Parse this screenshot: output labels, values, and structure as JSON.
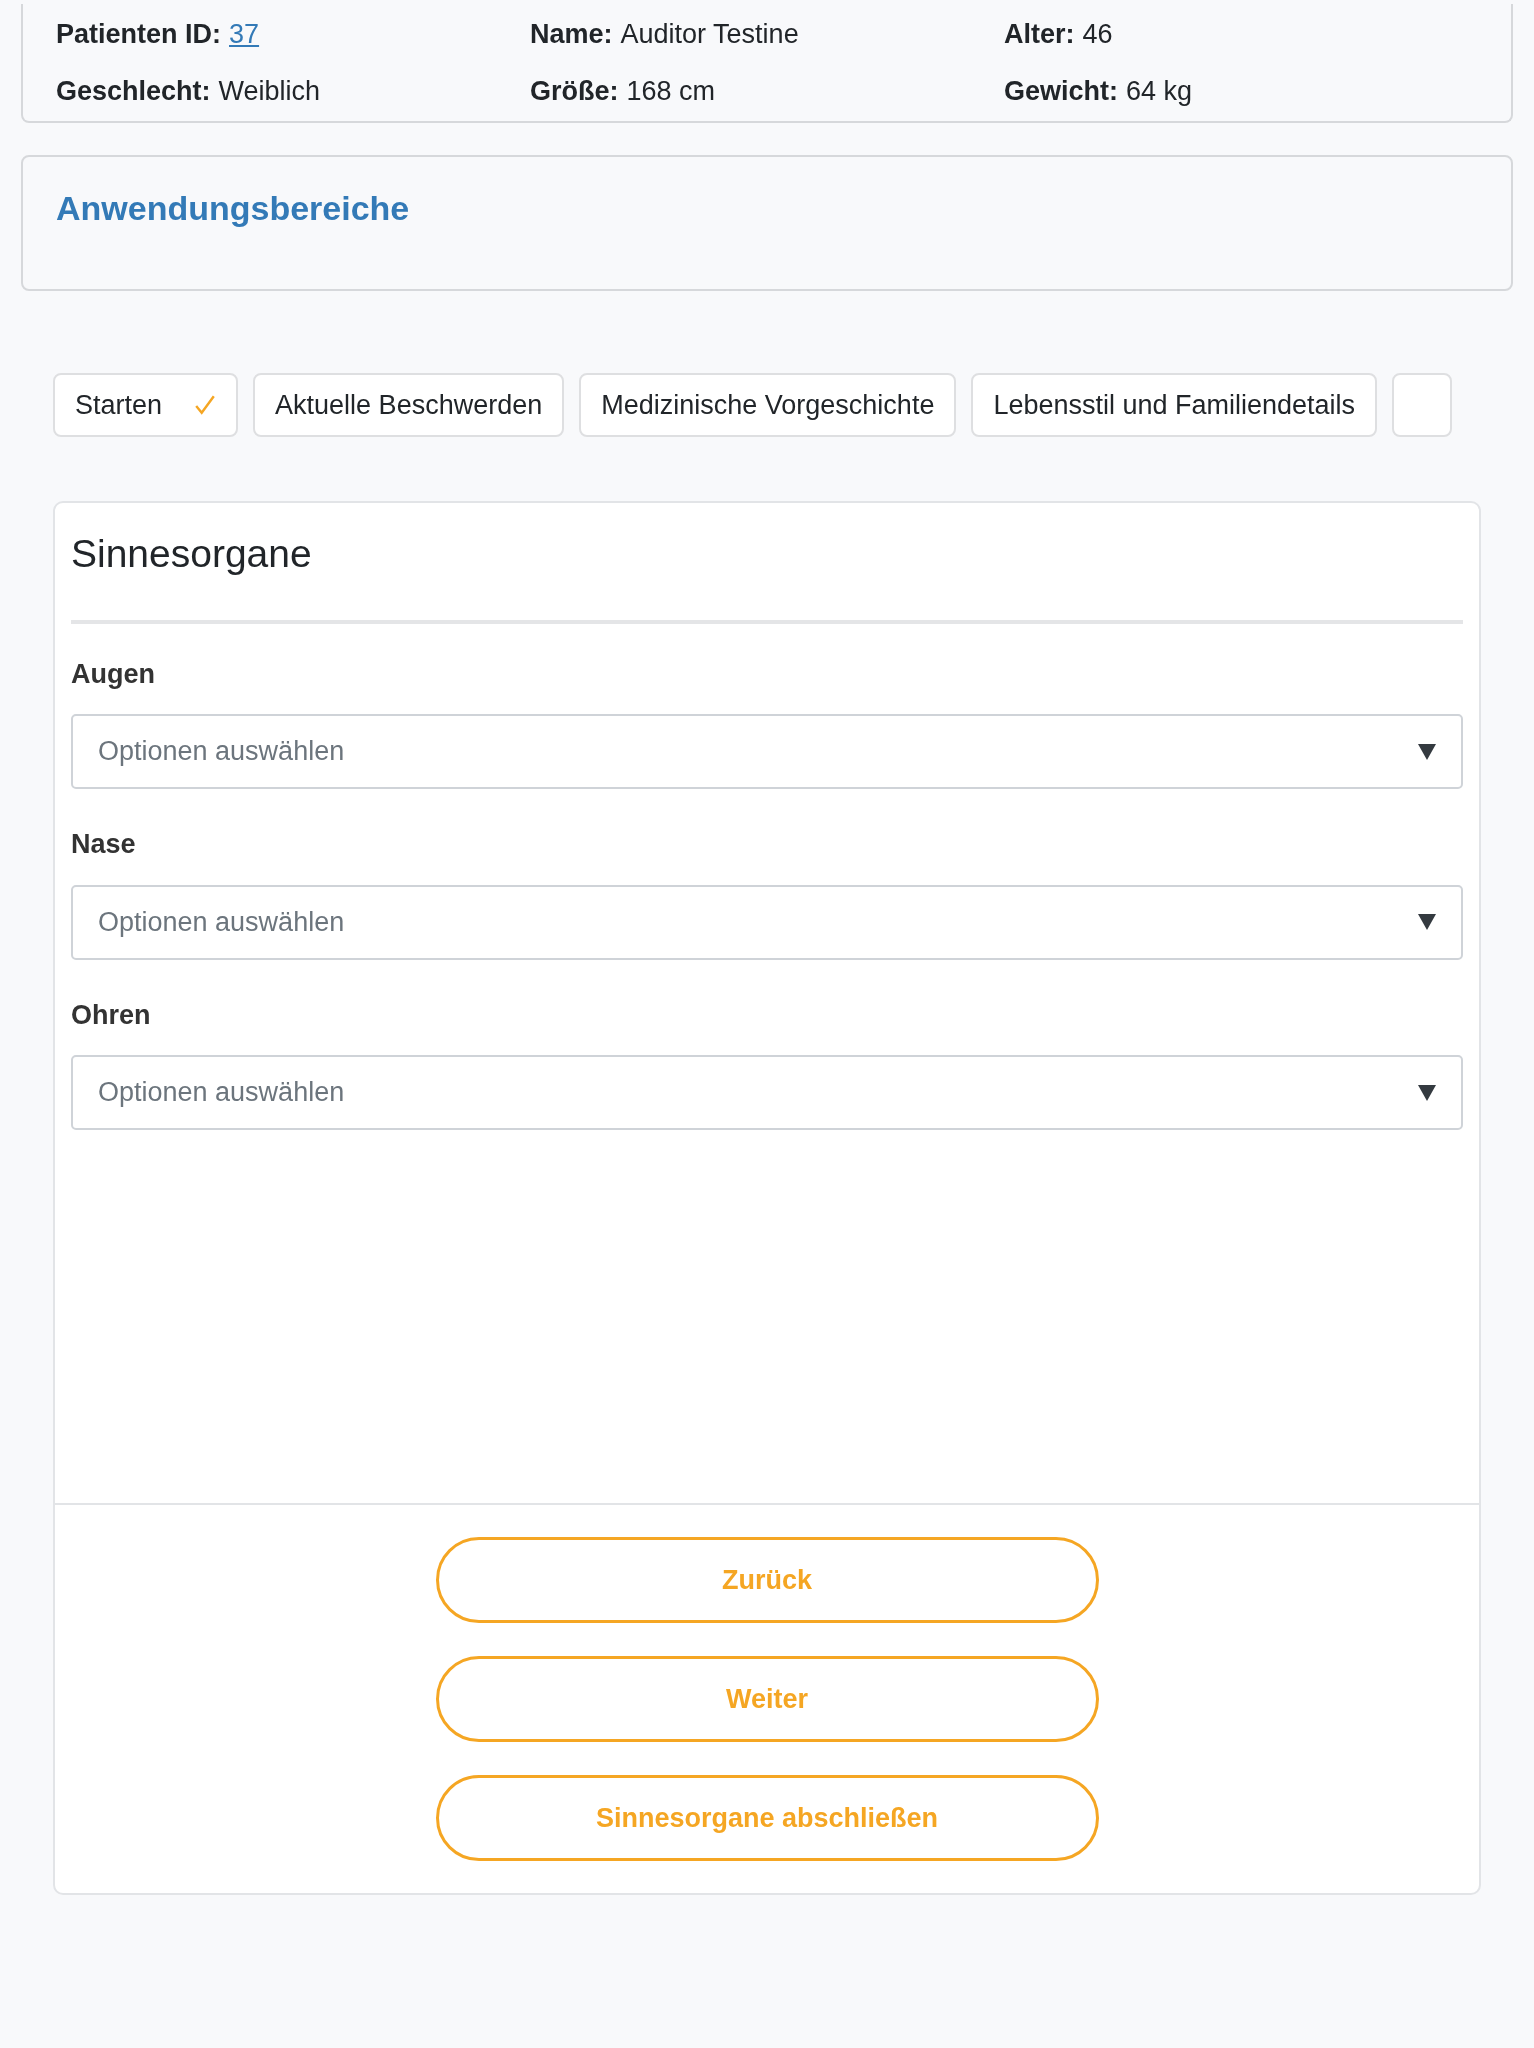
{
  "patient": {
    "fields": [
      {
        "label": "Patienten ID:",
        "value": "37",
        "kind": "link"
      },
      {
        "label": "Name:",
        "value": "Auditor Testine",
        "kind": "text"
      },
      {
        "label": "Alter:",
        "value": "46",
        "kind": "text"
      },
      {
        "label": "Geschlecht:",
        "value": "Weiblich",
        "kind": "text"
      },
      {
        "label": "Größe:",
        "value": "168 cm",
        "kind": "text"
      },
      {
        "label": "Gewicht:",
        "value": "64 kg",
        "kind": "text"
      }
    ]
  },
  "section_title": "Anwendungsbereiche",
  "tabs": [
    {
      "label": "Starten",
      "completed": true
    },
    {
      "label": "Aktuelle Beschwerden",
      "completed": false
    },
    {
      "label": "Medizinische Vorgeschichte",
      "completed": false
    },
    {
      "label": "Lebensstil und Familiendetails",
      "completed": false
    }
  ],
  "form": {
    "title": "Sinnesorgane",
    "fields": [
      {
        "label": "Augen",
        "placeholder": "Optionen auswählen"
      },
      {
        "label": "Nase",
        "placeholder": "Optionen auswählen"
      },
      {
        "label": "Ohren",
        "placeholder": "Optionen auswählen"
      }
    ],
    "buttons": [
      "Zurück",
      "Weiter",
      "Sinnesorgane abschließen"
    ]
  }
}
